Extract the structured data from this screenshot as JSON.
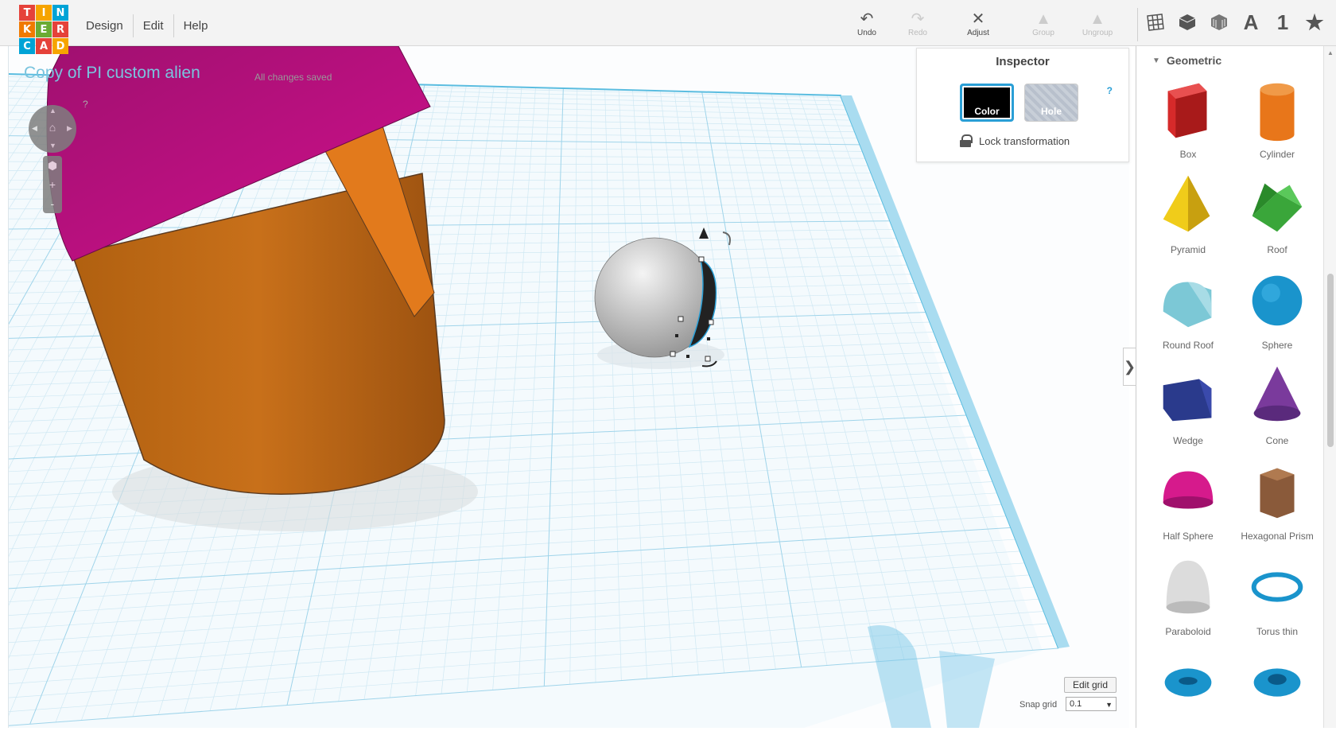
{
  "app": {
    "logo_letters": [
      "T",
      "I",
      "N",
      "K",
      "E",
      "R",
      "C",
      "A",
      "D"
    ],
    "logo_colors": [
      "#e5423a",
      "#f6a400",
      "#00a3d6",
      "#f07a00",
      "#6bab33",
      "#e5423a",
      "#00a3d6",
      "#e5423a",
      "#f6a400"
    ]
  },
  "menu": {
    "items": [
      "Design",
      "Edit",
      "Help"
    ]
  },
  "toolbar": {
    "undo": "Undo",
    "redo": "Redo",
    "adjust": "Adjust",
    "group": "Group",
    "ungroup": "Ungroup"
  },
  "view_icons": {
    "text_label": "A",
    "number_label": "1"
  },
  "design": {
    "title": "Copy of PI custom alien",
    "save_status": "All changes saved"
  },
  "view_controls": {
    "help": "?",
    "zoom_in": "+",
    "zoom_out": "-"
  },
  "inspector": {
    "title": "Inspector",
    "help": "?",
    "color_label": "Color",
    "hole_label": "Hole",
    "lock_label": "Lock transformation",
    "selected_color": "#000000"
  },
  "panel": {
    "section": "Geometric",
    "shapes": [
      {
        "label": "Box",
        "icon": "box-icon",
        "color": "#d62a2a"
      },
      {
        "label": "Cylinder",
        "icon": "cylinder-icon",
        "color": "#e8761a"
      },
      {
        "label": "Pyramid",
        "icon": "pyramid-icon",
        "color": "#f0cc1a"
      },
      {
        "label": "Roof",
        "icon": "roof-icon",
        "color": "#3aa63a"
      },
      {
        "label": "Round Roof",
        "icon": "round-roof-icon",
        "color": "#7cc8d6"
      },
      {
        "label": "Sphere",
        "icon": "sphere-icon",
        "color": "#1a94cc"
      },
      {
        "label": "Wedge",
        "icon": "wedge-icon",
        "color": "#2a3a8c"
      },
      {
        "label": "Cone",
        "icon": "cone-icon",
        "color": "#7a3a9c"
      },
      {
        "label": "Half Sphere",
        "icon": "half-sphere-icon",
        "color": "#d61a8c"
      },
      {
        "label": "Hexagonal Prism",
        "icon": "hexagonal-prism-icon",
        "color": "#8a5a3a"
      },
      {
        "label": "Paraboloid",
        "icon": "paraboloid-icon",
        "color": "#dcdcdc"
      },
      {
        "label": "Torus thin",
        "icon": "torus-thin-icon",
        "color": "#1a94cc"
      },
      {
        "label": "",
        "icon": "torus-icon",
        "color": "#1a94cc"
      },
      {
        "label": "",
        "icon": "tube-icon",
        "color": "#1a94cc"
      }
    ]
  },
  "grid_controls": {
    "edit_grid": "Edit grid",
    "snap_label": "Snap grid",
    "snap_value": "0.1"
  }
}
